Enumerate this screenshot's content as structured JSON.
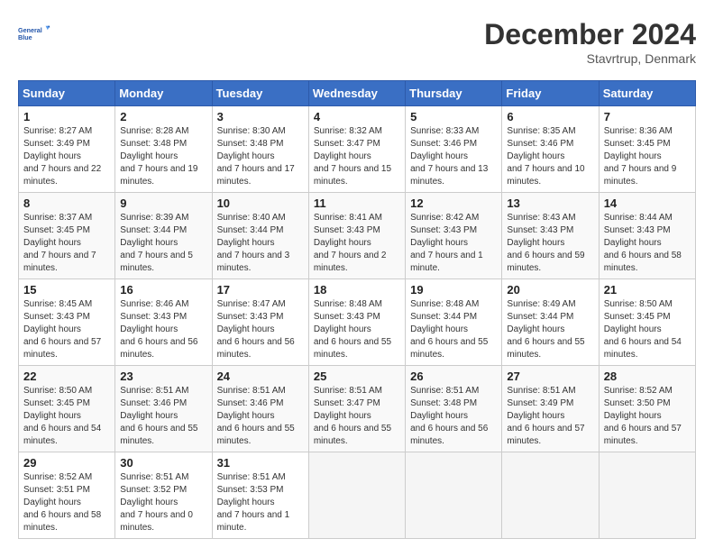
{
  "header": {
    "logo_line1": "General",
    "logo_line2": "Blue",
    "month": "December 2024",
    "location": "Stavrtrup, Denmark"
  },
  "days_of_week": [
    "Sunday",
    "Monday",
    "Tuesday",
    "Wednesday",
    "Thursday",
    "Friday",
    "Saturday"
  ],
  "weeks": [
    [
      {
        "day": "1",
        "sunrise": "8:27 AM",
        "sunset": "3:49 PM",
        "daylight": "7 hours and 22 minutes."
      },
      {
        "day": "2",
        "sunrise": "8:28 AM",
        "sunset": "3:48 PM",
        "daylight": "7 hours and 19 minutes."
      },
      {
        "day": "3",
        "sunrise": "8:30 AM",
        "sunset": "3:48 PM",
        "daylight": "7 hours and 17 minutes."
      },
      {
        "day": "4",
        "sunrise": "8:32 AM",
        "sunset": "3:47 PM",
        "daylight": "7 hours and 15 minutes."
      },
      {
        "day": "5",
        "sunrise": "8:33 AM",
        "sunset": "3:46 PM",
        "daylight": "7 hours and 13 minutes."
      },
      {
        "day": "6",
        "sunrise": "8:35 AM",
        "sunset": "3:46 PM",
        "daylight": "7 hours and 10 minutes."
      },
      {
        "day": "7",
        "sunrise": "8:36 AM",
        "sunset": "3:45 PM",
        "daylight": "7 hours and 9 minutes."
      }
    ],
    [
      {
        "day": "8",
        "sunrise": "8:37 AM",
        "sunset": "3:45 PM",
        "daylight": "7 hours and 7 minutes."
      },
      {
        "day": "9",
        "sunrise": "8:39 AM",
        "sunset": "3:44 PM",
        "daylight": "7 hours and 5 minutes."
      },
      {
        "day": "10",
        "sunrise": "8:40 AM",
        "sunset": "3:44 PM",
        "daylight": "7 hours and 3 minutes."
      },
      {
        "day": "11",
        "sunrise": "8:41 AM",
        "sunset": "3:43 PM",
        "daylight": "7 hours and 2 minutes."
      },
      {
        "day": "12",
        "sunrise": "8:42 AM",
        "sunset": "3:43 PM",
        "daylight": "7 hours and 1 minute."
      },
      {
        "day": "13",
        "sunrise": "8:43 AM",
        "sunset": "3:43 PM",
        "daylight": "6 hours and 59 minutes."
      },
      {
        "day": "14",
        "sunrise": "8:44 AM",
        "sunset": "3:43 PM",
        "daylight": "6 hours and 58 minutes."
      }
    ],
    [
      {
        "day": "15",
        "sunrise": "8:45 AM",
        "sunset": "3:43 PM",
        "daylight": "6 hours and 57 minutes."
      },
      {
        "day": "16",
        "sunrise": "8:46 AM",
        "sunset": "3:43 PM",
        "daylight": "6 hours and 56 minutes."
      },
      {
        "day": "17",
        "sunrise": "8:47 AM",
        "sunset": "3:43 PM",
        "daylight": "6 hours and 56 minutes."
      },
      {
        "day": "18",
        "sunrise": "8:48 AM",
        "sunset": "3:43 PM",
        "daylight": "6 hours and 55 minutes."
      },
      {
        "day": "19",
        "sunrise": "8:48 AM",
        "sunset": "3:44 PM",
        "daylight": "6 hours and 55 minutes."
      },
      {
        "day": "20",
        "sunrise": "8:49 AM",
        "sunset": "3:44 PM",
        "daylight": "6 hours and 55 minutes."
      },
      {
        "day": "21",
        "sunrise": "8:50 AM",
        "sunset": "3:45 PM",
        "daylight": "6 hours and 54 minutes."
      }
    ],
    [
      {
        "day": "22",
        "sunrise": "8:50 AM",
        "sunset": "3:45 PM",
        "daylight": "6 hours and 54 minutes."
      },
      {
        "day": "23",
        "sunrise": "8:51 AM",
        "sunset": "3:46 PM",
        "daylight": "6 hours and 55 minutes."
      },
      {
        "day": "24",
        "sunrise": "8:51 AM",
        "sunset": "3:46 PM",
        "daylight": "6 hours and 55 minutes."
      },
      {
        "day": "25",
        "sunrise": "8:51 AM",
        "sunset": "3:47 PM",
        "daylight": "6 hours and 55 minutes."
      },
      {
        "day": "26",
        "sunrise": "8:51 AM",
        "sunset": "3:48 PM",
        "daylight": "6 hours and 56 minutes."
      },
      {
        "day": "27",
        "sunrise": "8:51 AM",
        "sunset": "3:49 PM",
        "daylight": "6 hours and 57 minutes."
      },
      {
        "day": "28",
        "sunrise": "8:52 AM",
        "sunset": "3:50 PM",
        "daylight": "6 hours and 57 minutes."
      }
    ],
    [
      {
        "day": "29",
        "sunrise": "8:52 AM",
        "sunset": "3:51 PM",
        "daylight": "6 hours and 58 minutes."
      },
      {
        "day": "30",
        "sunrise": "8:51 AM",
        "sunset": "3:52 PM",
        "daylight": "7 hours and 0 minutes."
      },
      {
        "day": "31",
        "sunrise": "8:51 AM",
        "sunset": "3:53 PM",
        "daylight": "7 hours and 1 minute."
      },
      null,
      null,
      null,
      null
    ]
  ]
}
